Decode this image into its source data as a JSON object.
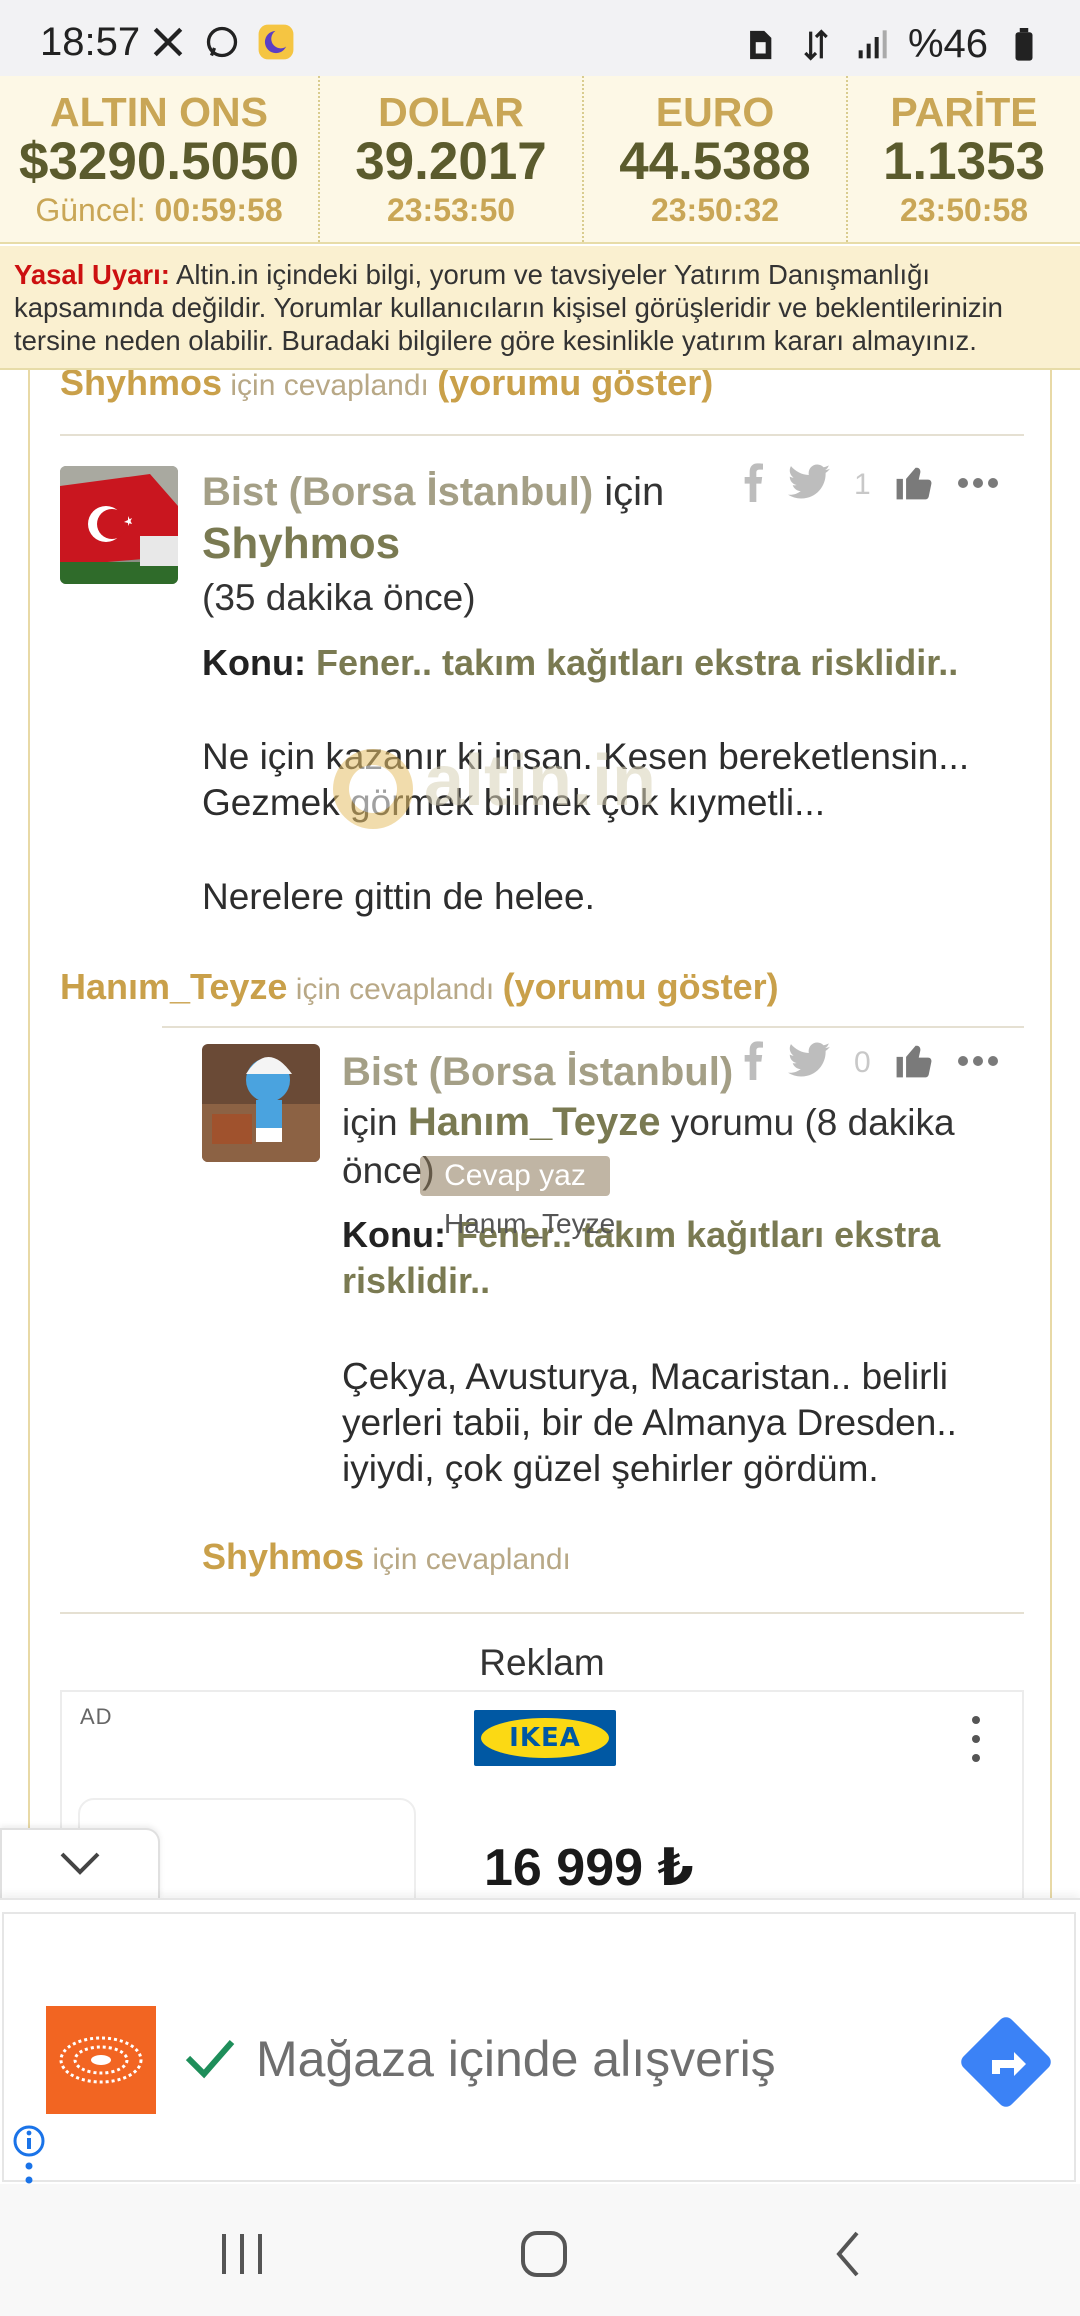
{
  "status_bar": {
    "time": "18:57",
    "battery": "%46",
    "icons": [
      "x-icon",
      "whatsapp-icon",
      "moon-app-icon",
      "sim-icon",
      "data-icon",
      "signal-icon",
      "battery-icon"
    ]
  },
  "ticker": [
    {
      "label": "ALTIN ONS",
      "value": "$3290.5050",
      "time_prefix": "Güncel: ",
      "time": "00:59:58"
    },
    {
      "label": "DOLAR",
      "value": "39.2017",
      "time_prefix": "",
      "time": "23:53:50"
    },
    {
      "label": "EURO",
      "value": "44.5388",
      "time_prefix": "",
      "time": "23:50:32"
    },
    {
      "label": "PARİTE",
      "value": "1.1353",
      "time_prefix": "",
      "time": "23:50:58"
    }
  ],
  "warning": {
    "label": "Yasal Uyarı:",
    "text": " Altin.in içindeki bilgi, yorum ve tavsiyeler Yatırım Danışmanlığı kapsamında değildir. Yorumlar kullanıcıların kişisel görüşleridir ve beklentilerinizin tersine neden olabilir. Buradaki bilgilere göre kesinlikle yatırım kararı almayınız."
  },
  "reply_top": {
    "user": "Shyhmos",
    "mid": " için cevaplandı ",
    "link": "(yorumu göster)"
  },
  "comment1": {
    "topic_title": "Bist (Borsa İstanbul)",
    "for_word": " için",
    "author": "Shyhmos",
    "time": "(35 dakika önce)",
    "konu_label": "Konu:",
    "konu": "Fener.. takım kağıtları ekstra risklidir..",
    "body1": "Ne için kazanır ki insan. Kesen bereketlensin... Gezmek görmek bilmek çok kıymetli...",
    "body2": "Nerelere gittin de helee.",
    "likes": "1"
  },
  "reply_mid": {
    "user": "Hanım_Teyze",
    "mid": " için cevaplandı ",
    "link": "(yorumu göster)"
  },
  "comment2": {
    "topic_title": "Bist (Borsa İstanbul)",
    "for_word": "için ",
    "author": "Hanım_Teyze",
    "after": " yorumu (8 dakika önce)",
    "konu_label": "Konu:",
    "konu": "Fener.. takım kağıtları ekstra risklidir..",
    "body": "Çekya, Avusturya, Macaristan.. belirli yerleri tabii, bir de Almanya Dresden.. iyiydi, çok güzel şehirler gördüm.",
    "likes": "0"
  },
  "overlay": {
    "watermark": "altin.in",
    "cevap_button": "Cevap yaz",
    "cevap_name": "Hanım_Teyze"
  },
  "reply_bottom": {
    "user": "Shyhmos",
    "mid": " için cevaplandı"
  },
  "ad": {
    "section_label": "Reklam",
    "ad_tag": "AD",
    "brand": "IKEA",
    "price": "16 999 ₺",
    "banner_text": "Mağaza içinde alışveriş",
    "colors": {
      "ikea_blue": "#0058a3",
      "ikea_yellow": "#fbd914",
      "banner_orange": "#f26522",
      "go_blue": "#3b82f6"
    }
  },
  "colors": {
    "gold": "#c9a04a",
    "olive": "#7a7a52",
    "warning_red": "#cc1010"
  }
}
